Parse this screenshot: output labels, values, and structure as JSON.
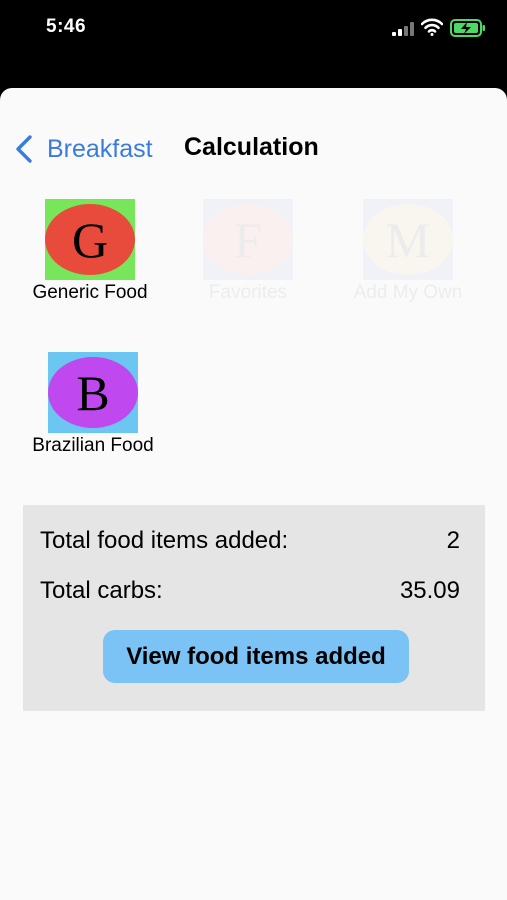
{
  "status_bar": {
    "time": "5:46",
    "icons": [
      "cellular-signal-icon",
      "wifi-icon",
      "battery-charging-icon"
    ]
  },
  "nav": {
    "back_label": "Breakfast",
    "title": "Calculation"
  },
  "tiles": [
    {
      "letter": "G",
      "label": "Generic Food",
      "square_color": "#78e65a",
      "circle_color": "#e84b3c"
    },
    {
      "letter": "F",
      "label": "Favorites",
      "square_color": "#5a78e6",
      "circle_color": "#e84b3c"
    },
    {
      "letter": "M",
      "label": "Add My Own",
      "square_color": "#5a78e6",
      "circle_color": "#f5b642"
    },
    {
      "letter": "B",
      "label": "Brazilian Food",
      "square_color": "#6cc6f2",
      "circle_color": "#bf48ef"
    }
  ],
  "summary": {
    "items_label": "Total food items added:",
    "items_value": "2",
    "carbs_label": "Total carbs:",
    "carbs_value": "35.09",
    "button_label": "View food items added"
  },
  "colors": {
    "accent": "#3a7be0",
    "button_bg": "#7cc3f5",
    "summary_bg": "#e5e5e5"
  }
}
